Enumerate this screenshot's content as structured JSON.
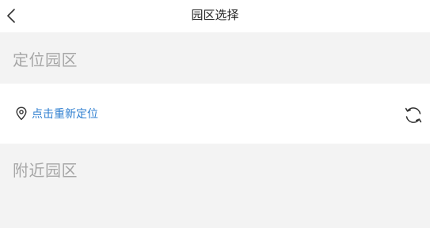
{
  "header": {
    "title": "园区选择",
    "back_icon": "chevron-left-icon"
  },
  "located_section": {
    "title": "定位园区"
  },
  "locate_row": {
    "pin_icon": "location-pin-icon",
    "link_label": "点击重新定位",
    "link_color": "#2f7fd0",
    "refresh_icon": "refresh-icon"
  },
  "nearby_section": {
    "title": "附近园区"
  },
  "colors": {
    "page_background": "#f3f3f3",
    "panel_background": "#ffffff",
    "section_title": "#a6a6a6"
  }
}
